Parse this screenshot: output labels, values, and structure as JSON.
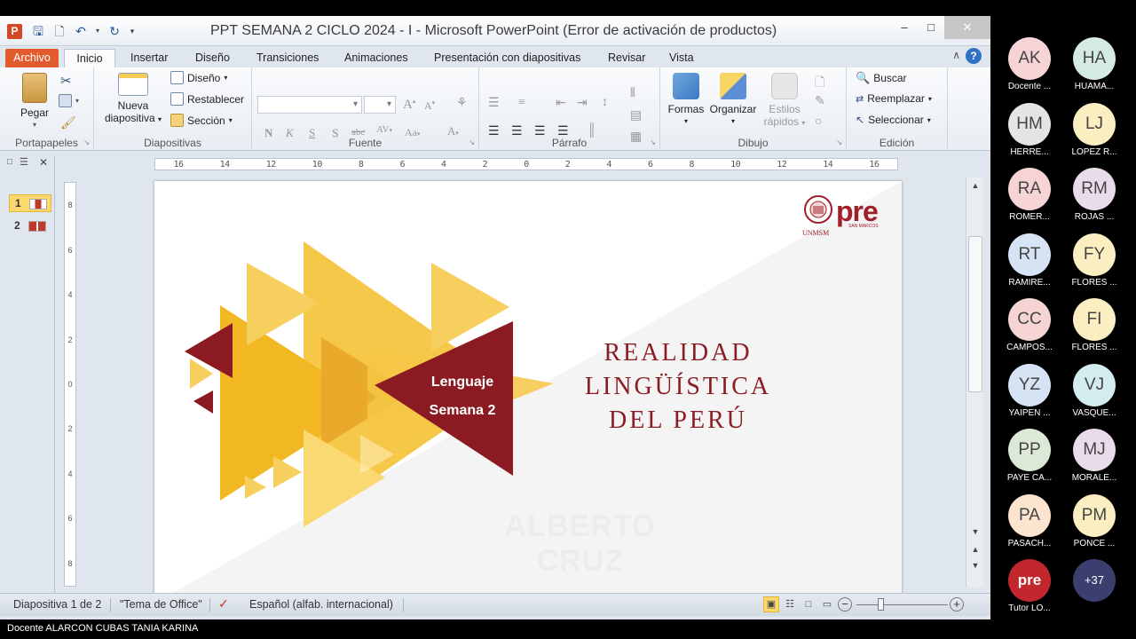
{
  "window": {
    "app_icon": "P",
    "title": "PPT SEMANA 2 CICLO 2024 - I  -  Microsoft PowerPoint (Error de activación de productos)"
  },
  "ribbon_tabs": [
    "Archivo",
    "Inicio",
    "Insertar",
    "Diseño",
    "Transiciones",
    "Animaciones",
    "Presentación con diapositivas",
    "Revisar",
    "Vista"
  ],
  "ribbon": {
    "portapapeles": {
      "label": "Portapapeles",
      "pegar": "Pegar"
    },
    "diapositivas": {
      "label": "Diapositivas",
      "nueva_line1": "Nueva",
      "nueva_line2": "diapositiva",
      "diseno": "Diseño",
      "restablecer": "Restablecer",
      "seccion": "Sección"
    },
    "fuente": {
      "label": "Fuente"
    },
    "parrafo": {
      "label": "Párrafo"
    },
    "dibujo": {
      "label": "Dibujo",
      "formas": "Formas",
      "organizar": "Organizar",
      "estilos_line1": "Estilos",
      "estilos_line2": "rápidos"
    },
    "edicion": {
      "label": "Edición",
      "buscar": "Buscar",
      "reemplazar": "Reemplazar",
      "seleccionar": "Seleccionar"
    }
  },
  "slides_panel": [
    {
      "num": "1",
      "selected": true
    },
    {
      "num": "2",
      "selected": false
    }
  ],
  "ruler_h": [
    "16",
    "14",
    "12",
    "10",
    "8",
    "6",
    "4",
    "2",
    "0",
    "2",
    "4",
    "6",
    "8",
    "10",
    "12",
    "14",
    "16"
  ],
  "ruler_v": [
    "8",
    "6",
    "4",
    "2",
    "0",
    "2",
    "4",
    "6",
    "8"
  ],
  "slide": {
    "title_lines": [
      "REALIDAD",
      "LINGÜÍSTICA",
      "DEL PERÚ"
    ],
    "tag_line1": "Lenguaje",
    "tag_line2": "Semana 2",
    "watermark": "ALBERTO CRUZ",
    "logo_text": "pre",
    "logo_sub": "UNMSM",
    "logo_small": "SAN MARCOS"
  },
  "status": {
    "slide_info": "Diapositiva 1 de 2",
    "theme": "\"Tema de Office\"",
    "language": "Español (alfab. internacional)"
  },
  "caption": "Docente ALARCON CUBAS TANIA KARINA",
  "participants": [
    {
      "initials": "AK",
      "name": "Docente ...",
      "color": "#f6d4d6"
    },
    {
      "initials": "HA",
      "name": "HUAMA...",
      "color": "#d3ebe3"
    },
    {
      "initials": "HM",
      "name": "HERRE...",
      "color": "#e4e4e4"
    },
    {
      "initials": "LJ",
      "name": "LOPEZ R...",
      "color": "#fbeec1"
    },
    {
      "initials": "RA",
      "name": "ROMER...",
      "color": "#f6d4d6"
    },
    {
      "initials": "RM",
      "name": "ROJAS ...",
      "color": "#eadbea"
    },
    {
      "initials": "RT",
      "name": "RAMIRE...",
      "color": "#d5e3f4"
    },
    {
      "initials": "FY",
      "name": "FLORES ...",
      "color": "#fbeec1"
    },
    {
      "initials": "CC",
      "name": "CAMPOS...",
      "color": "#f6d4d6"
    },
    {
      "initials": "FI",
      "name": "FLORES ...",
      "color": "#fbeec1"
    },
    {
      "initials": "YZ",
      "name": "YAIPEN ...",
      "color": "#d5e3f4"
    },
    {
      "initials": "VJ",
      "name": "VASQUE...",
      "color": "#d3ecef"
    },
    {
      "initials": "PP",
      "name": "PAYE CA...",
      "color": "#dce9d6"
    },
    {
      "initials": "MJ",
      "name": "MORALE...",
      "color": "#eadbea"
    },
    {
      "initials": "PA",
      "name": "PASACH...",
      "color": "#fbe5cf"
    },
    {
      "initials": "PM",
      "name": "PONCE ...",
      "color": "#fbeec1"
    },
    {
      "initials": "pre",
      "name": "Tutor LO...",
      "color": "#c1272d"
    },
    {
      "initials": "+37",
      "name": "",
      "color": "#3a3f70"
    }
  ]
}
